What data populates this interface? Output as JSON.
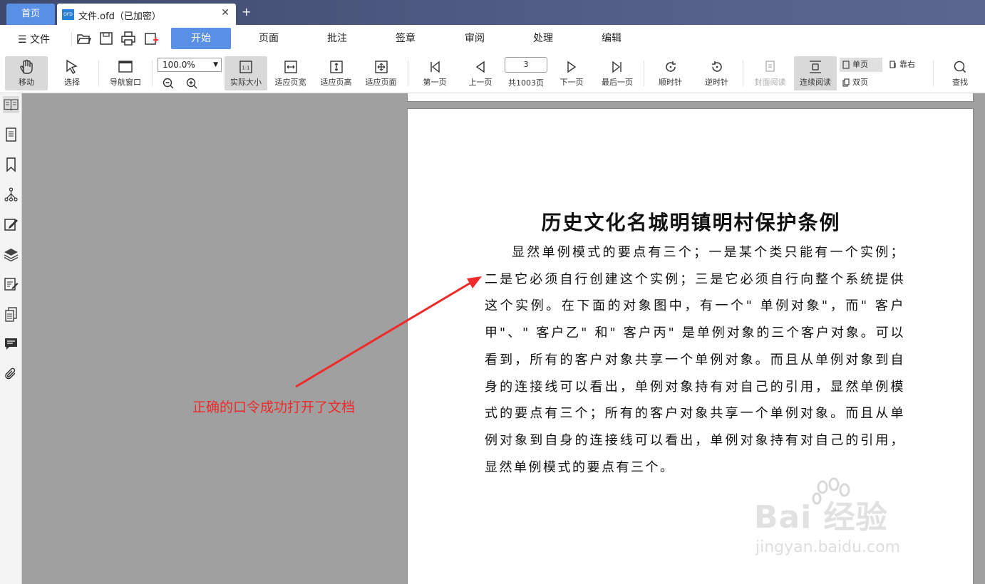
{
  "tabs": {
    "home_label": "首页",
    "doc_badge": "OFD",
    "doc_title": "文件.ofd（已加密）",
    "close_glyph": "✕",
    "new_tab_glyph": "+"
  },
  "menu": {
    "file_label": "☰ 文件",
    "tabs": [
      "开始",
      "页面",
      "批注",
      "签章",
      "审阅",
      "处理",
      "编辑"
    ]
  },
  "toolbar": {
    "move": "移动",
    "select": "选择",
    "nav_window": "导航窗口",
    "zoom_value": "100.0%",
    "actual_size": "实际大小",
    "fit_width": "适应页宽",
    "fit_height": "适应页高",
    "fit_page": "适应页面",
    "first_page": "第一页",
    "prev_page": "上一页",
    "current_page": "3",
    "total_pages": "共1003页",
    "next_page": "下一页",
    "last_page": "最后一页",
    "rotate_cw": "顺时针",
    "rotate_ccw": "逆时针",
    "cover_read": "封面阅读",
    "continuous_read": "连续阅读",
    "single_page": "单页",
    "double_page": "双页",
    "align_right": "靠右",
    "find": "查找"
  },
  "document": {
    "title": "历史文化名城明镇明村保护条例",
    "body": "显然单例模式的要点有三个；一是某个类只能有一个实例；二是它必须自行创建这个实例；三是它必须自行向整个系统提供这个实例。在下面的对象图中，有一个\" 单例对象\"，而\" 客户甲\"、\" 客户乙\" 和\" 客户丙\" 是单例对象的三个客户对象。可以看到，所有的客户对象共享一个单例对象。而且从单例对象到自身的连接线可以看出，单例对象持有对自己的引用，显然单例模式的要点有三个；所有的客户对象共享一个单例对象。而且从单例对象到自身的连接线可以看出，单例对象持有对自己的引用，显然单例模式的要点有三个。"
  },
  "annotation": {
    "text": "正确的口令成功打开了文档",
    "color": "#ee2a2a"
  },
  "watermark": {
    "brand": "Bai 经验",
    "url": "jingyan.baidu.com"
  },
  "colors": {
    "accent": "#5a8fe6",
    "tabbar": "#4a5578"
  }
}
